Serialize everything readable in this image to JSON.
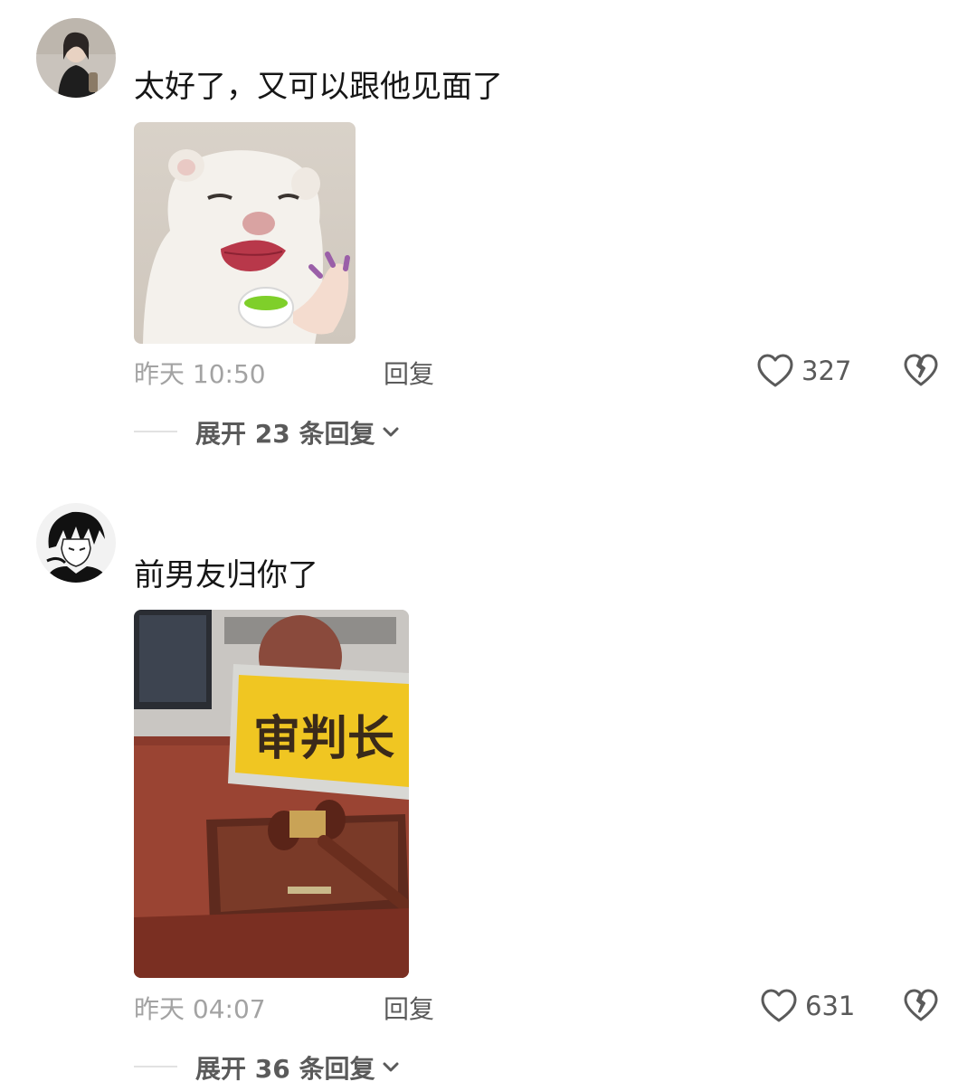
{
  "comments": [
    {
      "avatar": "avatar-girl",
      "text": "太好了，又可以跟他见面了",
      "image": "meme-ferret-tea",
      "time": "昨天 10:50",
      "reply_label": "回复",
      "likes": "327",
      "expand_label": "展开 23 条回复"
    },
    {
      "avatar": "avatar-anime-boy",
      "text": "前男友归你了",
      "image": "judge-gavel-photo",
      "image_caption": "审判长",
      "time": "昨天 04:07",
      "reply_label": "回复",
      "likes": "631",
      "expand_label": "展开 36 条回复"
    }
  ],
  "icons": {
    "like": "heart-outline-icon",
    "dislike": "broken-heart-icon",
    "expand": "chevron-down-icon"
  }
}
